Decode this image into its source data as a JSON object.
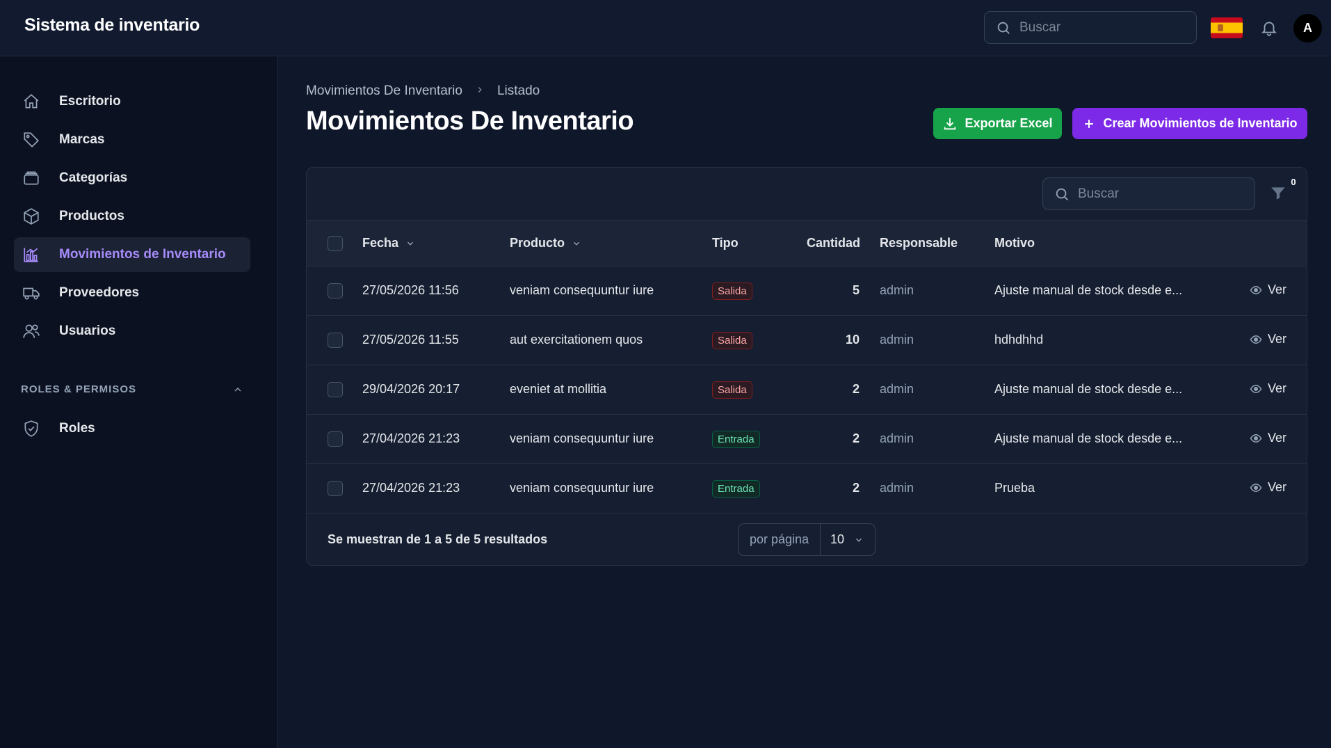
{
  "app": {
    "title": "Sistema de inventario"
  },
  "topbar": {
    "search_placeholder": "Buscar",
    "avatar_initial": "A"
  },
  "sidebar": {
    "items": [
      {
        "label": "Escritorio",
        "icon": "home-icon"
      },
      {
        "label": "Marcas",
        "icon": "tag-icon"
      },
      {
        "label": "Categorías",
        "icon": "folder-icon"
      },
      {
        "label": "Productos",
        "icon": "cube-icon"
      },
      {
        "label": "Movimientos de Inventario",
        "icon": "chart-icon",
        "active": true
      },
      {
        "label": "Proveedores",
        "icon": "truck-icon"
      },
      {
        "label": "Usuarios",
        "icon": "users-icon"
      }
    ],
    "group_label": "ROLES & PERMISOS",
    "group_items": [
      {
        "label": "Roles",
        "icon": "shield-icon"
      }
    ]
  },
  "breadcrumb": {
    "parent": "Movimientos De Inventario",
    "current": "Listado"
  },
  "page": {
    "title": "Movimientos De Inventario",
    "export_label": "Exportar Excel",
    "create_label": "Crear Movimientos de Inventario"
  },
  "table": {
    "search_placeholder": "Buscar",
    "filter_count": "0",
    "columns": {
      "fecha": "Fecha",
      "producto": "Producto",
      "tipo": "Tipo",
      "cantidad": "Cantidad",
      "responsable": "Responsable",
      "motivo": "Motivo"
    },
    "rows": [
      {
        "fecha": "27/05/2026 11:56",
        "producto": "veniam consequuntur iure",
        "tipo": "Salida",
        "cantidad": "5",
        "responsable": "admin",
        "motivo": "Ajuste manual de stock desde e...",
        "action": "Ver"
      },
      {
        "fecha": "27/05/2026 11:55",
        "producto": "aut exercitationem quos",
        "tipo": "Salida",
        "cantidad": "10",
        "responsable": "admin",
        "motivo": "hdhdhhd",
        "action": "Ver"
      },
      {
        "fecha": "29/04/2026 20:17",
        "producto": "eveniet at mollitia",
        "tipo": "Salida",
        "cantidad": "2",
        "responsable": "admin",
        "motivo": "Ajuste manual de stock desde e...",
        "action": "Ver"
      },
      {
        "fecha": "27/04/2026 21:23",
        "producto": "veniam consequuntur iure",
        "tipo": "Entrada",
        "cantidad": "2",
        "responsable": "admin",
        "motivo": "Ajuste manual de stock desde e...",
        "action": "Ver"
      },
      {
        "fecha": "27/04/2026 21:23",
        "producto": "veniam consequuntur iure",
        "tipo": "Entrada",
        "cantidad": "2",
        "responsable": "admin",
        "motivo": "Prueba",
        "action": "Ver"
      }
    ],
    "footer": {
      "results_text": "Se muestran de 1 a 5 de 5 resultados",
      "per_page_label": "por página",
      "per_page_value": "10"
    }
  },
  "colors": {
    "accent": "#a78bfa",
    "export_button": "#16a34a",
    "create_button": "#7c2ae8",
    "salida": "#fca5a5",
    "entrada": "#6ee7b7"
  }
}
